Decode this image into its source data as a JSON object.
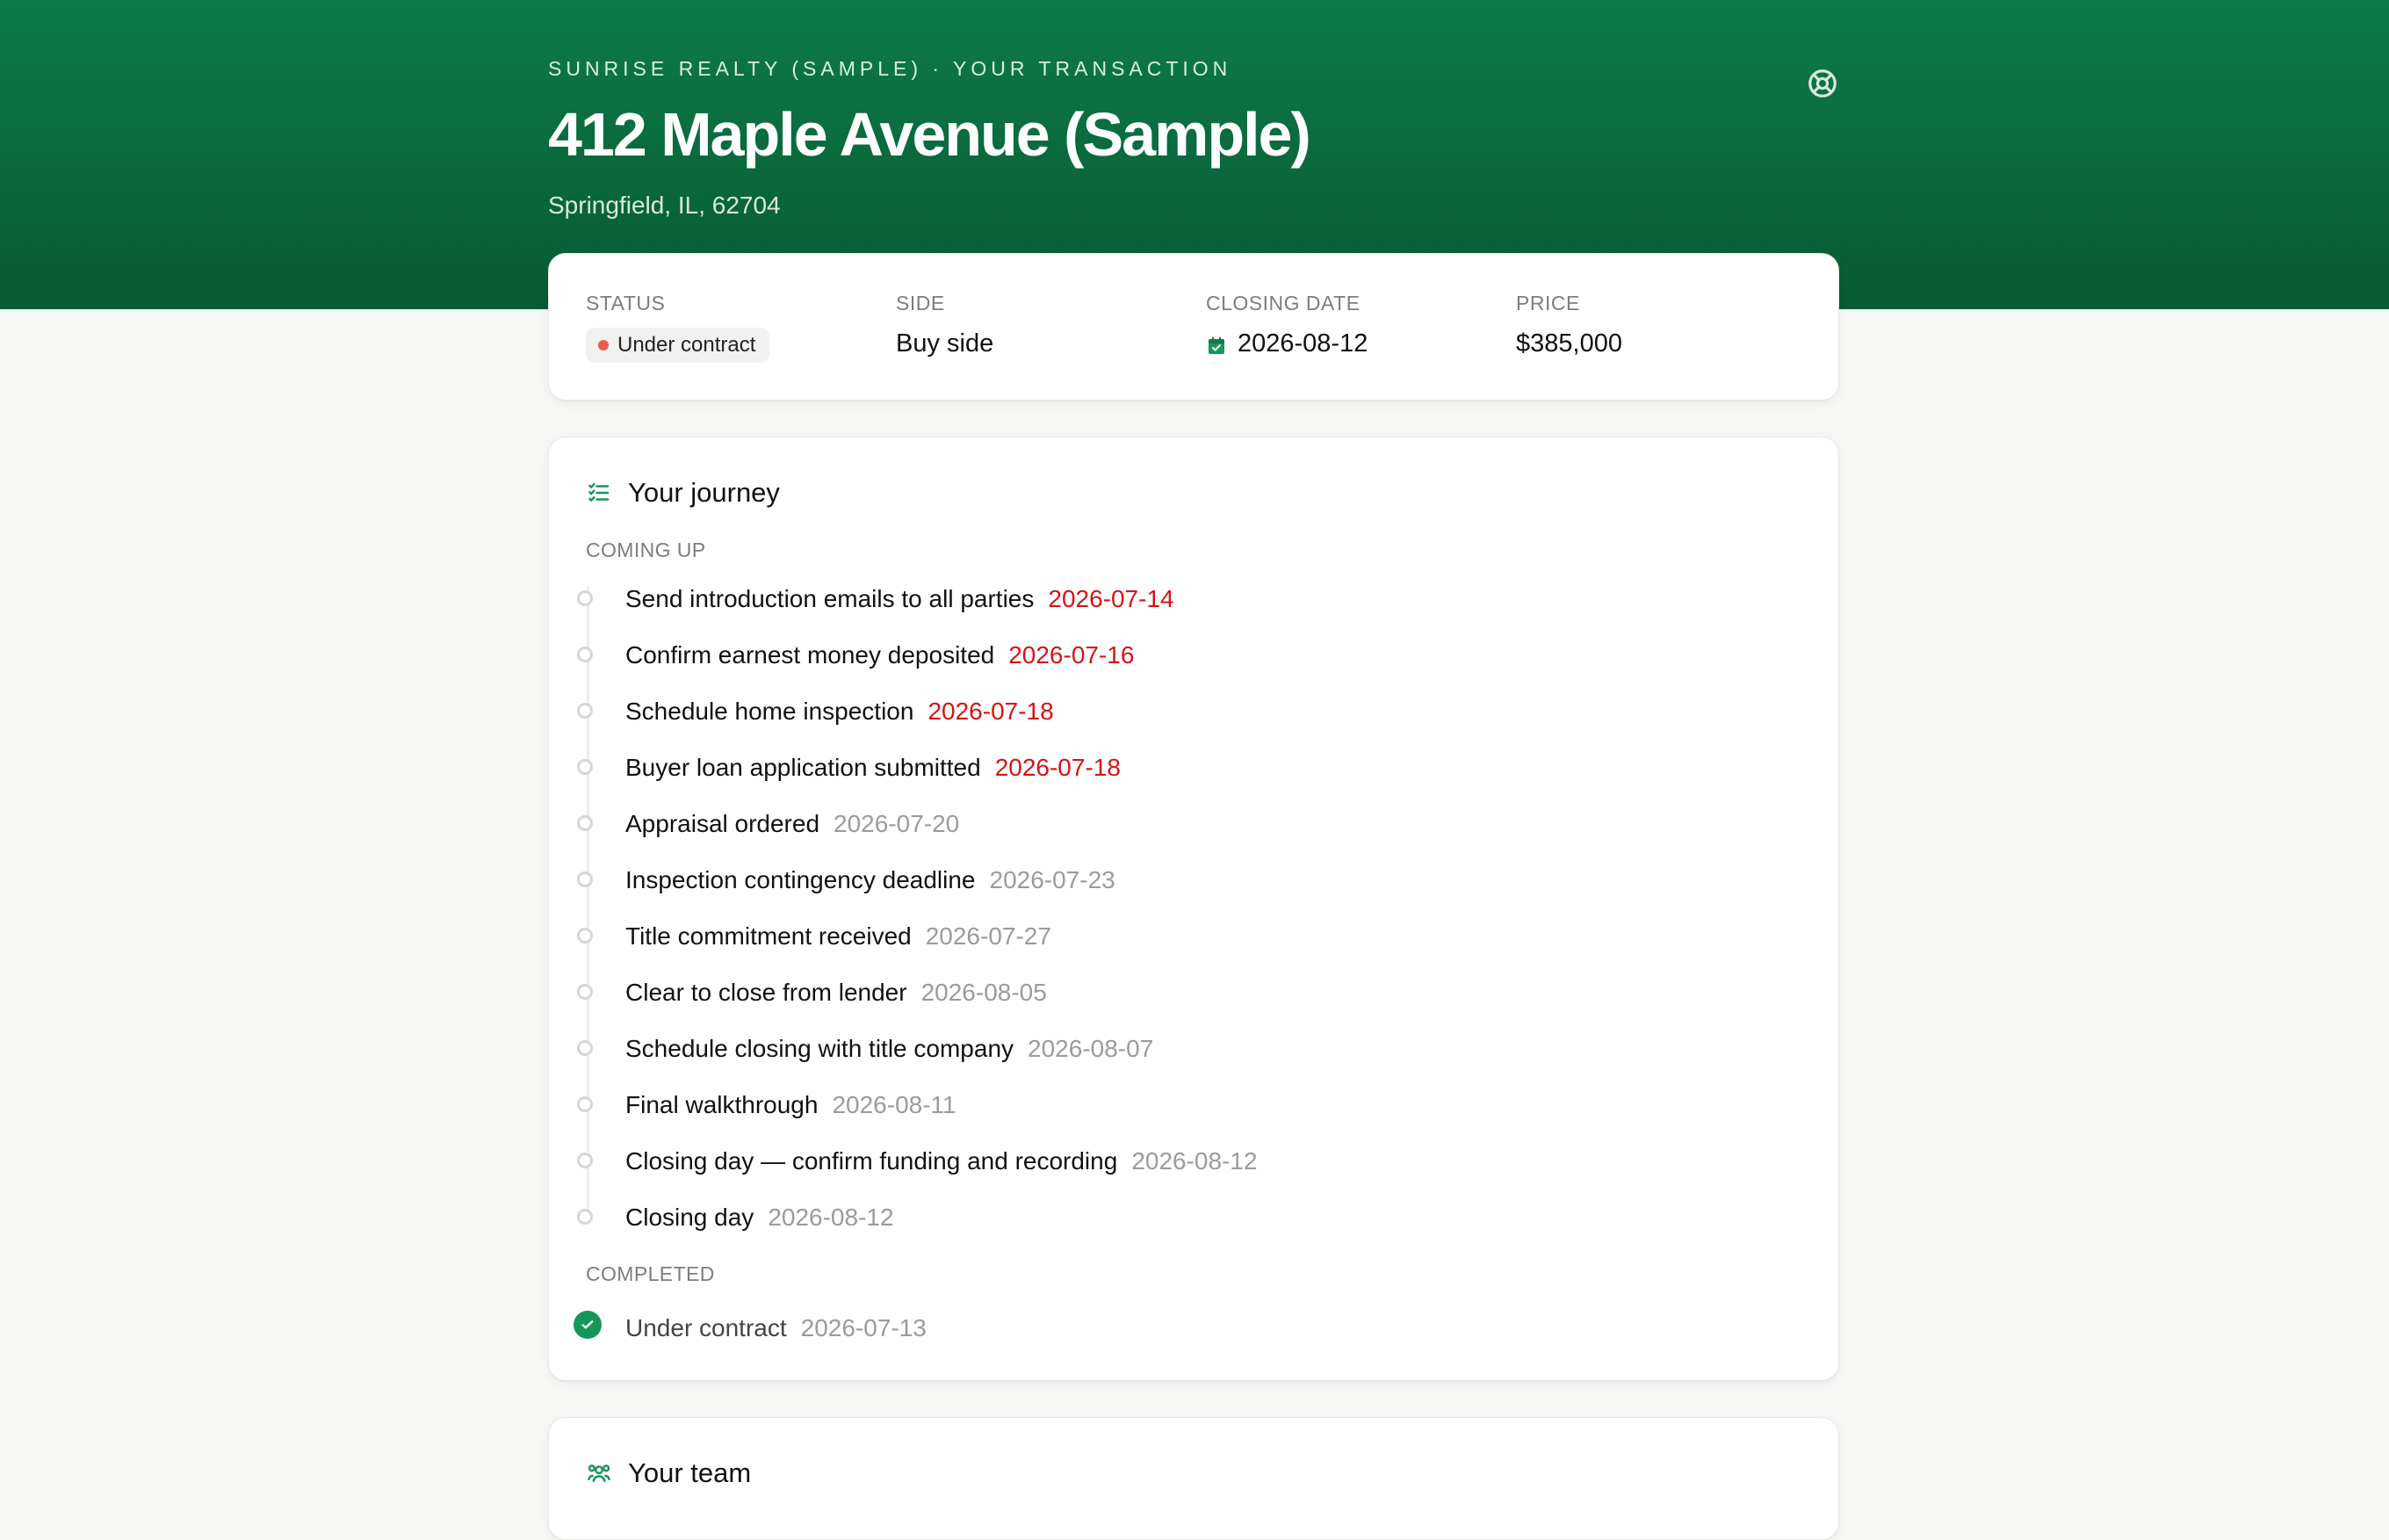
{
  "header": {
    "eyebrow": "SUNRISE REALTY (SAMPLE) · YOUR TRANSACTION",
    "title": "412 Maple Avenue (Sample)",
    "location": "Springfield, IL, 62704",
    "help_icon": "lifebuoy-icon"
  },
  "summary": {
    "status": {
      "label": "STATUS",
      "value": "Under contract",
      "dot_color": "#ea5a4f"
    },
    "side": {
      "label": "SIDE",
      "value": "Buy side"
    },
    "closing_date": {
      "label": "CLOSING DATE",
      "value": "2026-08-12",
      "icon": "calendar-check-icon"
    },
    "price": {
      "label": "PRICE",
      "value": "$385,000"
    }
  },
  "journey": {
    "title": "Your journey",
    "icon": "checklist-icon",
    "coming_up_label": "COMING UP",
    "completed_label": "COMPLETED",
    "coming_up": [
      {
        "title": "Send introduction emails to all parties",
        "date": "2026-07-14"
      },
      {
        "title": "Confirm earnest money deposited",
        "date": "2026-07-16"
      },
      {
        "title": "Schedule home inspection",
        "date": "2026-07-18"
      },
      {
        "title": "Buyer loan application submitted",
        "date": "2026-07-18"
      },
      {
        "title": "Appraisal ordered",
        "date": "2026-07-20"
      },
      {
        "title": "Inspection contingency deadline",
        "date": "2026-07-23"
      },
      {
        "title": "Title commitment received",
        "date": "2026-07-27"
      },
      {
        "title": "Clear to close from lender",
        "date": "2026-08-05"
      },
      {
        "title": "Schedule closing with title company",
        "date": "2026-08-07"
      },
      {
        "title": "Final walkthrough",
        "date": "2026-08-11"
      },
      {
        "title": "Closing day — confirm funding and recording",
        "date": "2026-08-12"
      },
      {
        "title": "Closing day",
        "date": "2026-08-12"
      }
    ],
    "completed": [
      {
        "title": "Under contract",
        "date": "2026-07-13"
      }
    ]
  },
  "team": {
    "title": "Your team",
    "icon": "team-icon"
  },
  "colors": {
    "brand_green": "#0a6a3d",
    "accent_green": "#17965b",
    "due_red": "#d51414",
    "muted_gray": "#9b9b98"
  }
}
